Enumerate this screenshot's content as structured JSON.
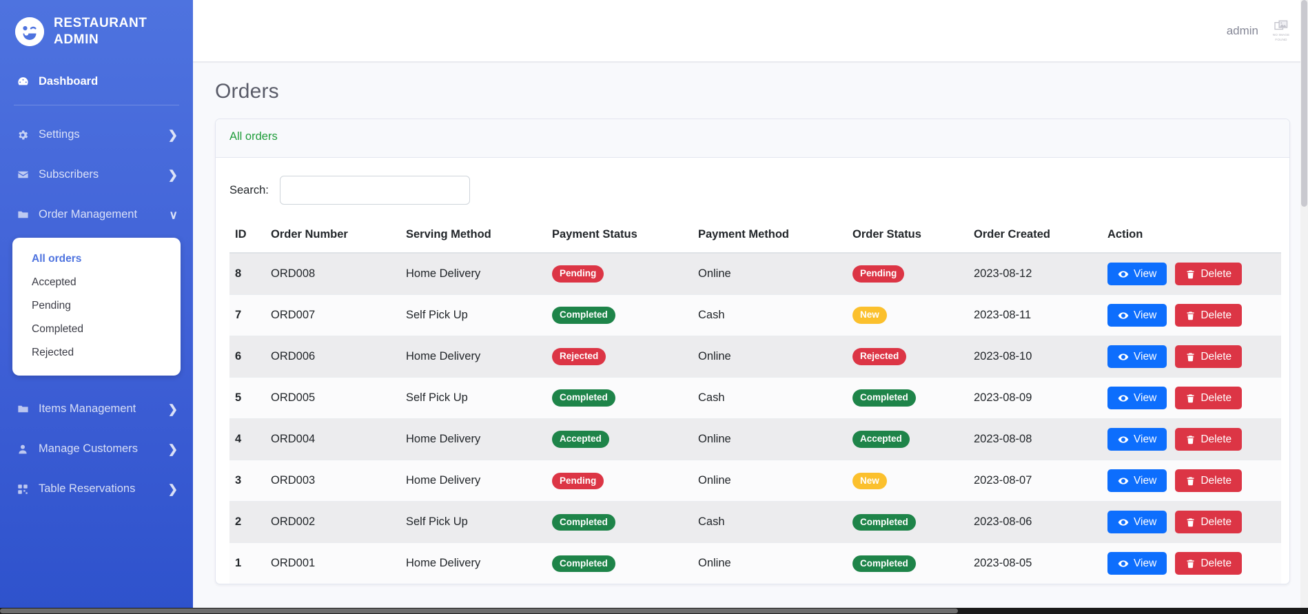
{
  "brand": {
    "title": "RESTAURANT ADMIN",
    "logo_icon": "winking-smiley-icon"
  },
  "sidebar": {
    "items": [
      {
        "label": "Dashboard",
        "icon": "speedometer-icon",
        "active": true,
        "caret": ""
      },
      {
        "label": "Settings",
        "icon": "gear-icon",
        "active": false,
        "caret": "❯"
      },
      {
        "label": "Subscribers",
        "icon": "envelope-icon",
        "active": false,
        "caret": "❯"
      },
      {
        "label": "Order Management",
        "icon": "folder-icon",
        "active": false,
        "caret": "∨"
      },
      {
        "label": "Items Management",
        "icon": "folder-icon",
        "active": false,
        "caret": "❯"
      },
      {
        "label": "Manage Customers",
        "icon": "user-icon",
        "active": false,
        "caret": "❯"
      },
      {
        "label": "Table Reservations",
        "icon": "grid-icon",
        "active": false,
        "caret": "❯"
      }
    ],
    "order_submenu": [
      {
        "label": "All orders",
        "active": true
      },
      {
        "label": "Accepted",
        "active": false
      },
      {
        "label": "Pending",
        "active": false
      },
      {
        "label": "Completed",
        "active": false
      },
      {
        "label": "Rejected",
        "active": false
      }
    ]
  },
  "topbar": {
    "username": "admin",
    "avatar_alt_line1": "NO IMAGE",
    "avatar_alt_line2": "FOUND",
    "avatar_icon": "broken-image-icon"
  },
  "page": {
    "title": "Orders"
  },
  "card": {
    "header_title": "All orders"
  },
  "search": {
    "label": "Search:",
    "value": "",
    "placeholder": ""
  },
  "table": {
    "columns": [
      "ID",
      "Order Number",
      "Serving Method",
      "Payment Status",
      "Payment Method",
      "Order Status",
      "Order Created",
      "Action"
    ],
    "action_labels": {
      "view": "View",
      "delete": "Delete"
    },
    "rows": [
      {
        "id": "8",
        "order_number": "ORD008",
        "serving_method": "Home Delivery",
        "payment_status": "Pending",
        "payment_status_style": "danger",
        "payment_method": "Online",
        "order_status": "Pending",
        "order_status_style": "danger",
        "order_created": "2023-08-12"
      },
      {
        "id": "7",
        "order_number": "ORD007",
        "serving_method": "Self Pick Up",
        "payment_status": "Completed",
        "payment_status_style": "success",
        "payment_method": "Cash",
        "order_status": "New",
        "order_status_style": "warning",
        "order_created": "2023-08-11"
      },
      {
        "id": "6",
        "order_number": "ORD006",
        "serving_method": "Home Delivery",
        "payment_status": "Rejected",
        "payment_status_style": "danger",
        "payment_method": "Online",
        "order_status": "Rejected",
        "order_status_style": "danger",
        "order_created": "2023-08-10"
      },
      {
        "id": "5",
        "order_number": "ORD005",
        "serving_method": "Self Pick Up",
        "payment_status": "Completed",
        "payment_status_style": "success",
        "payment_method": "Cash",
        "order_status": "Completed",
        "order_status_style": "success",
        "order_created": "2023-08-09"
      },
      {
        "id": "4",
        "order_number": "ORD004",
        "serving_method": "Home Delivery",
        "payment_status": "Accepted",
        "payment_status_style": "success",
        "payment_method": "Online",
        "order_status": "Accepted",
        "order_status_style": "success",
        "order_created": "2023-08-08"
      },
      {
        "id": "3",
        "order_number": "ORD003",
        "serving_method": "Home Delivery",
        "payment_status": "Pending",
        "payment_status_style": "danger",
        "payment_method": "Online",
        "order_status": "New",
        "order_status_style": "warning",
        "order_created": "2023-08-07"
      },
      {
        "id": "2",
        "order_number": "ORD002",
        "serving_method": "Self Pick Up",
        "payment_status": "Completed",
        "payment_status_style": "success",
        "payment_method": "Cash",
        "order_status": "Completed",
        "order_status_style": "success",
        "order_created": "2023-08-06"
      },
      {
        "id": "1",
        "order_number": "ORD001",
        "serving_method": "Home Delivery",
        "payment_status": "Completed",
        "payment_status_style": "success",
        "payment_method": "Online",
        "order_status": "Completed",
        "order_status_style": "success",
        "order_created": "2023-08-05"
      }
    ]
  },
  "colors": {
    "sidebar": "#4e73df",
    "accent_green": "#1f9d3a",
    "badge_danger": "#dc3545",
    "badge_success": "#1e8449",
    "badge_warning": "#fbc02d",
    "btn_view": "#0d6efd",
    "btn_delete": "#dc3545",
    "page_title": "#5a5c69"
  }
}
